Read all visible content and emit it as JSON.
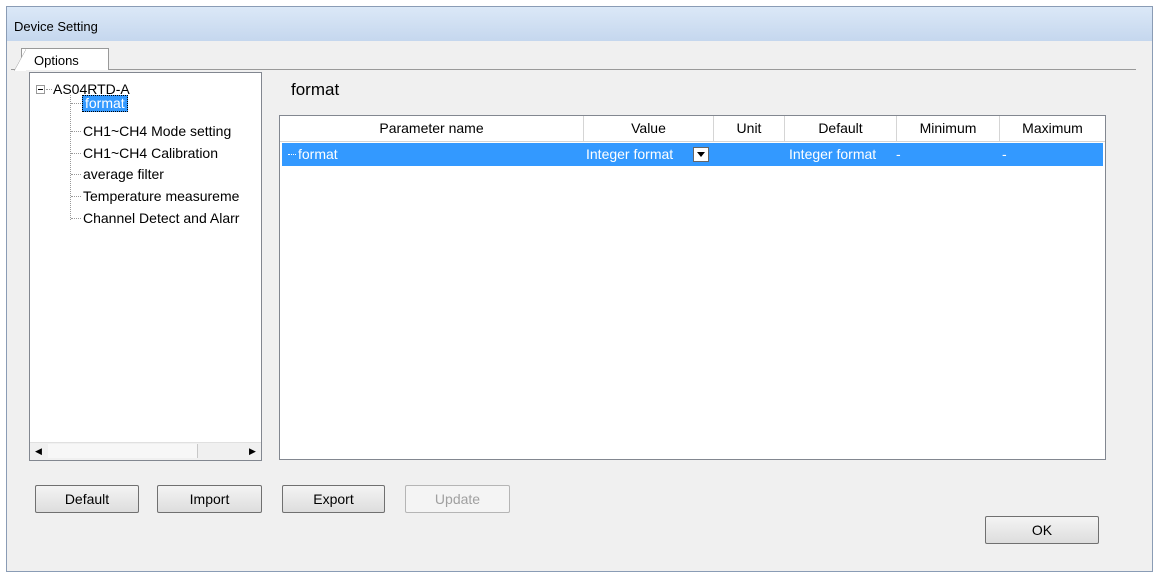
{
  "window": {
    "title": "Device Setting"
  },
  "tabs": [
    {
      "label": "Options"
    }
  ],
  "tree": {
    "root": "AS04RTD-A",
    "items": [
      {
        "label": "format",
        "selected": true
      },
      {
        "label": "CH1~CH4 Mode setting"
      },
      {
        "label": "CH1~CH4 Calibration"
      },
      {
        "label": "average filter"
      },
      {
        "label": "Temperature measureme"
      },
      {
        "label": "Channel Detect and Alarr"
      }
    ]
  },
  "section": {
    "title": "format"
  },
  "grid": {
    "columns": [
      "Parameter name",
      "Value",
      "Unit",
      "Default",
      "Minimum",
      "Maximum"
    ],
    "rows": [
      {
        "name": "format",
        "value": "Integer format",
        "unit": "",
        "default": "Integer format",
        "minimum": "-",
        "maximum": "-",
        "selected": true
      }
    ]
  },
  "buttons": {
    "default": "Default",
    "import": "Import",
    "export": "Export",
    "update": "Update",
    "ok": "OK"
  },
  "colors": {
    "selection": "#3399ff",
    "titlebar": "#c5d7ee"
  },
  "icons": [
    "collapse-icon",
    "scroll-left-icon",
    "scroll-right-icon",
    "dropdown-arrow-icon"
  ]
}
